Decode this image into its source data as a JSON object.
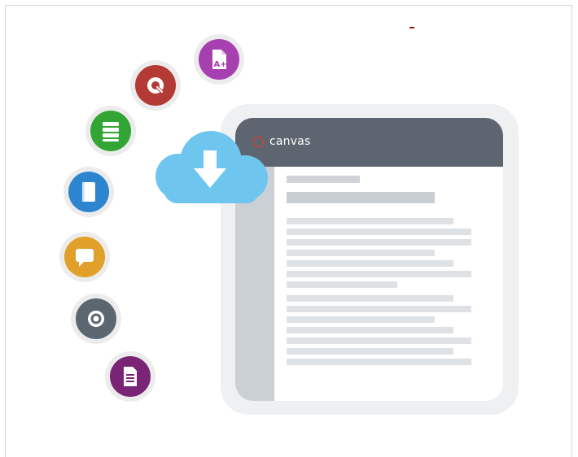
{
  "app": {
    "brand_name": "canvas",
    "brand_color": "#e63a2e"
  },
  "colors": {
    "header": "#5d6570",
    "sidebar": "#cbd0d5",
    "cloud": "#6ec6ef"
  },
  "icons": [
    {
      "name": "grades-icon",
      "color": "#a63fb0"
    },
    {
      "name": "quiz-icon",
      "color": "#b43a35"
    },
    {
      "name": "modules-icon",
      "color": "#33a534"
    },
    {
      "name": "pages-icon",
      "color": "#2d84cf"
    },
    {
      "name": "discussion-icon",
      "color": "#e0a02a"
    },
    {
      "name": "record-icon",
      "color": "#5b6670"
    },
    {
      "name": "syllabus-icon",
      "color": "#7a2475"
    },
    {
      "name": "cloud-download-icon",
      "color": "#6ec6ef"
    }
  ]
}
